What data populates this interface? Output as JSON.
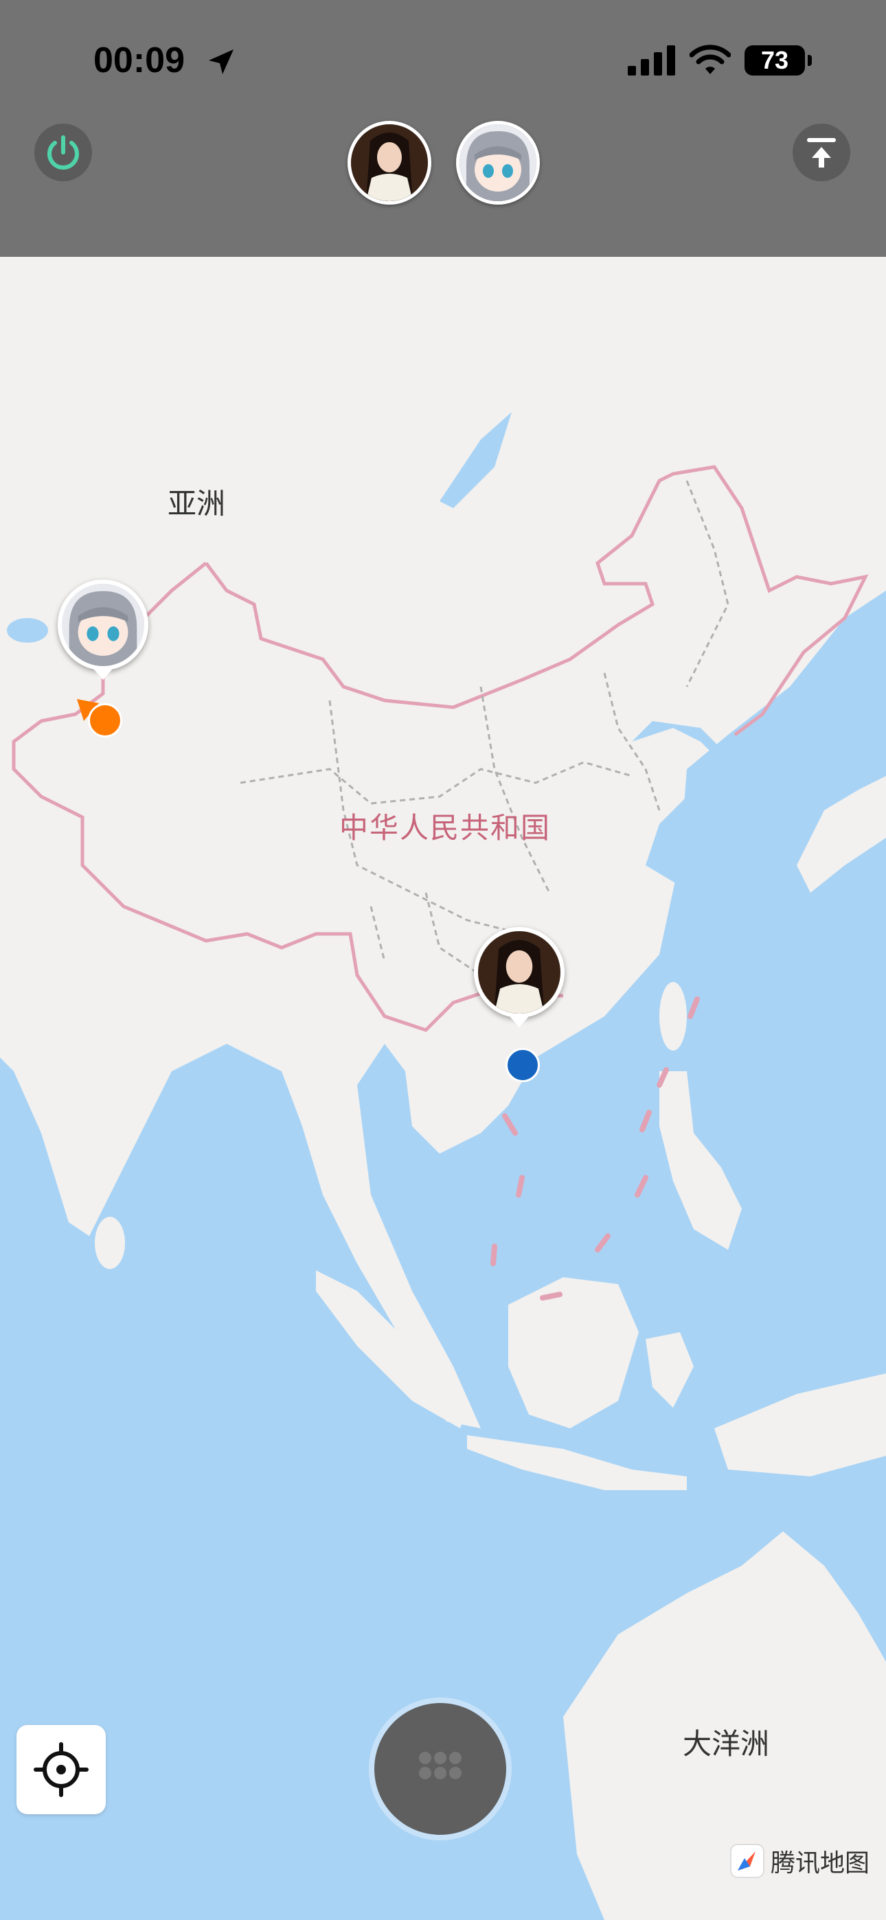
{
  "status_bar": {
    "time": "00:09",
    "battery": "73",
    "icons": [
      "location-arrow-icon",
      "signal-bars-icon",
      "wifi-icon",
      "battery-icon"
    ]
  },
  "toolbar": {
    "left_button_icon": "power-icon",
    "right_button_icon": "upload-icon",
    "avatars": [
      "user-avatar-woman",
      "user-avatar-anime"
    ]
  },
  "map": {
    "labels": {
      "asia": "亚洲",
      "china": "中华人民共和国",
      "oceania": "大洋洲"
    },
    "markers": [
      {
        "id": "anime-user",
        "dot_color": "#ff7a00"
      },
      {
        "id": "woman-user",
        "dot_color": "#1565c0"
      }
    ],
    "colors": {
      "water": "#a9d3f5",
      "land": "#f2f1ef",
      "border": "#e3a1b4",
      "accent_power": "#4fd3a8"
    }
  },
  "controls": {
    "locate_icon": "crosshair-icon",
    "menu_icon": "grid-dots-icon"
  },
  "brand": {
    "name": "腾讯地图"
  }
}
